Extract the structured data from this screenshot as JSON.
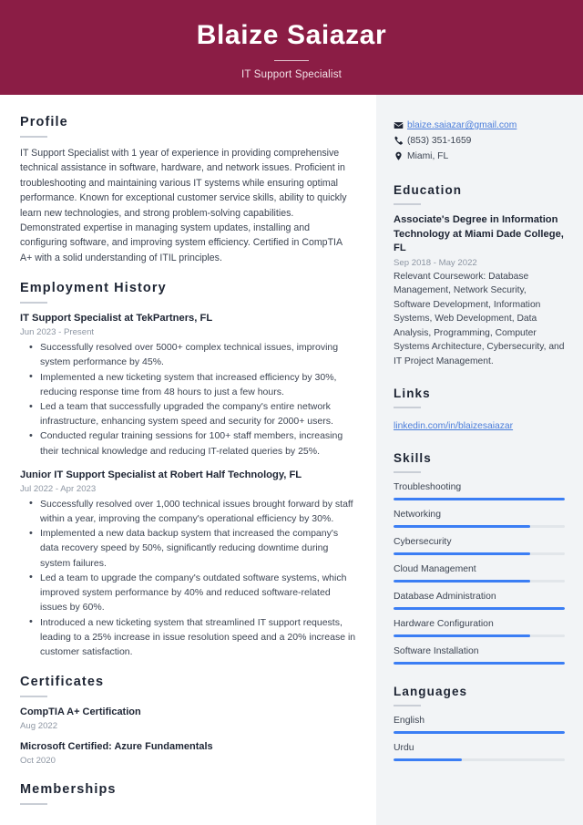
{
  "header": {
    "name": "Blaize Saiazar",
    "job_title": "IT Support Specialist",
    "background_color": "#8b1d45"
  },
  "theme": {
    "accent_bar_color": "#3b7ef4",
    "link_color": "#4a7ddb",
    "sidebar_background": "#f2f4f6",
    "heading_color": "#1d2433"
  },
  "main": {
    "profile": {
      "heading": "Profile",
      "text": "IT Support Specialist with 1 year of experience in providing comprehensive technical assistance in software, hardware, and network issues. Proficient in troubleshooting and maintaining various IT systems while ensuring optimal performance. Known for exceptional customer service skills, ability to quickly learn new technologies, and strong problem-solving capabilities. Demonstrated expertise in managing system updates, installing and configuring software, and improving system efficiency. Certified in CompTIA A+ with a solid understanding of ITIL principles."
    },
    "employment": {
      "heading": "Employment History",
      "entries": [
        {
          "title": "IT Support Specialist at TekPartners, FL",
          "date": "Jun 2023 - Present",
          "bullets": [
            "Successfully resolved over 5000+ complex technical issues, improving system performance by 45%.",
            "Implemented a new ticketing system that increased efficiency by 30%, reducing response time from 48 hours to just a few hours.",
            "Led a team that successfully upgraded the company's entire network infrastructure, enhancing system speed and security for 2000+ users.",
            "Conducted regular training sessions for 100+ staff members, increasing their technical knowledge and reducing IT-related queries by 25%."
          ]
        },
        {
          "title": "Junior IT Support Specialist at Robert Half Technology, FL",
          "date": "Jul 2022 - Apr 2023",
          "bullets": [
            "Successfully resolved over 1,000 technical issues brought forward by staff within a year, improving the company's operational efficiency by 30%.",
            "Implemented a new data backup system that increased the company's data recovery speed by 50%, significantly reducing downtime during system failures.",
            "Led a team to upgrade the company's outdated software systems, which improved system performance by 40% and reduced software-related issues by 60%.",
            "Introduced a new ticketing system that streamlined IT support requests, leading to a 25% increase in issue resolution speed and a 20% increase in customer satisfaction."
          ]
        }
      ]
    },
    "certificates": {
      "heading": "Certificates",
      "entries": [
        {
          "name": "CompTIA A+ Certification",
          "date": "Aug 2022"
        },
        {
          "name": "Microsoft Certified: Azure Fundamentals",
          "date": "Oct 2020"
        }
      ]
    },
    "memberships": {
      "heading": "Memberships"
    }
  },
  "sidebar": {
    "contact": [
      {
        "icon": "envelope-icon",
        "value": "blaize.saiazar@gmail.com",
        "is_link": true
      },
      {
        "icon": "phone-icon",
        "value": "(853) 351-1659",
        "is_link": false
      },
      {
        "icon": "location-pin-icon",
        "value": "Miami, FL",
        "is_link": false
      }
    ],
    "education": {
      "heading": "Education",
      "title": "Associate's Degree in Information Technology at Miami Dade College, FL",
      "date": "Sep 2018 - May 2022",
      "description": "Relevant Coursework: Database Management, Network Security, Software Development, Information Systems, Web Development, Data Analysis, Programming, Computer Systems Architecture, Cybersecurity, and IT Project Management."
    },
    "links": {
      "heading": "Links",
      "items": [
        {
          "label": "linkedin.com/in/blaizesaiazar"
        }
      ]
    },
    "skills": {
      "heading": "Skills",
      "items": [
        {
          "label": "Troubleshooting",
          "level": 100
        },
        {
          "label": "Networking",
          "level": 80
        },
        {
          "label": "Cybersecurity",
          "level": 80
        },
        {
          "label": "Cloud Management",
          "level": 80
        },
        {
          "label": "Database Administration",
          "level": 100
        },
        {
          "label": "Hardware Configuration",
          "level": 80
        },
        {
          "label": "Software Installation",
          "level": 100
        }
      ]
    },
    "languages": {
      "heading": "Languages",
      "items": [
        {
          "label": "English",
          "level": 100
        },
        {
          "label": "Urdu",
          "level": 40
        }
      ]
    }
  }
}
